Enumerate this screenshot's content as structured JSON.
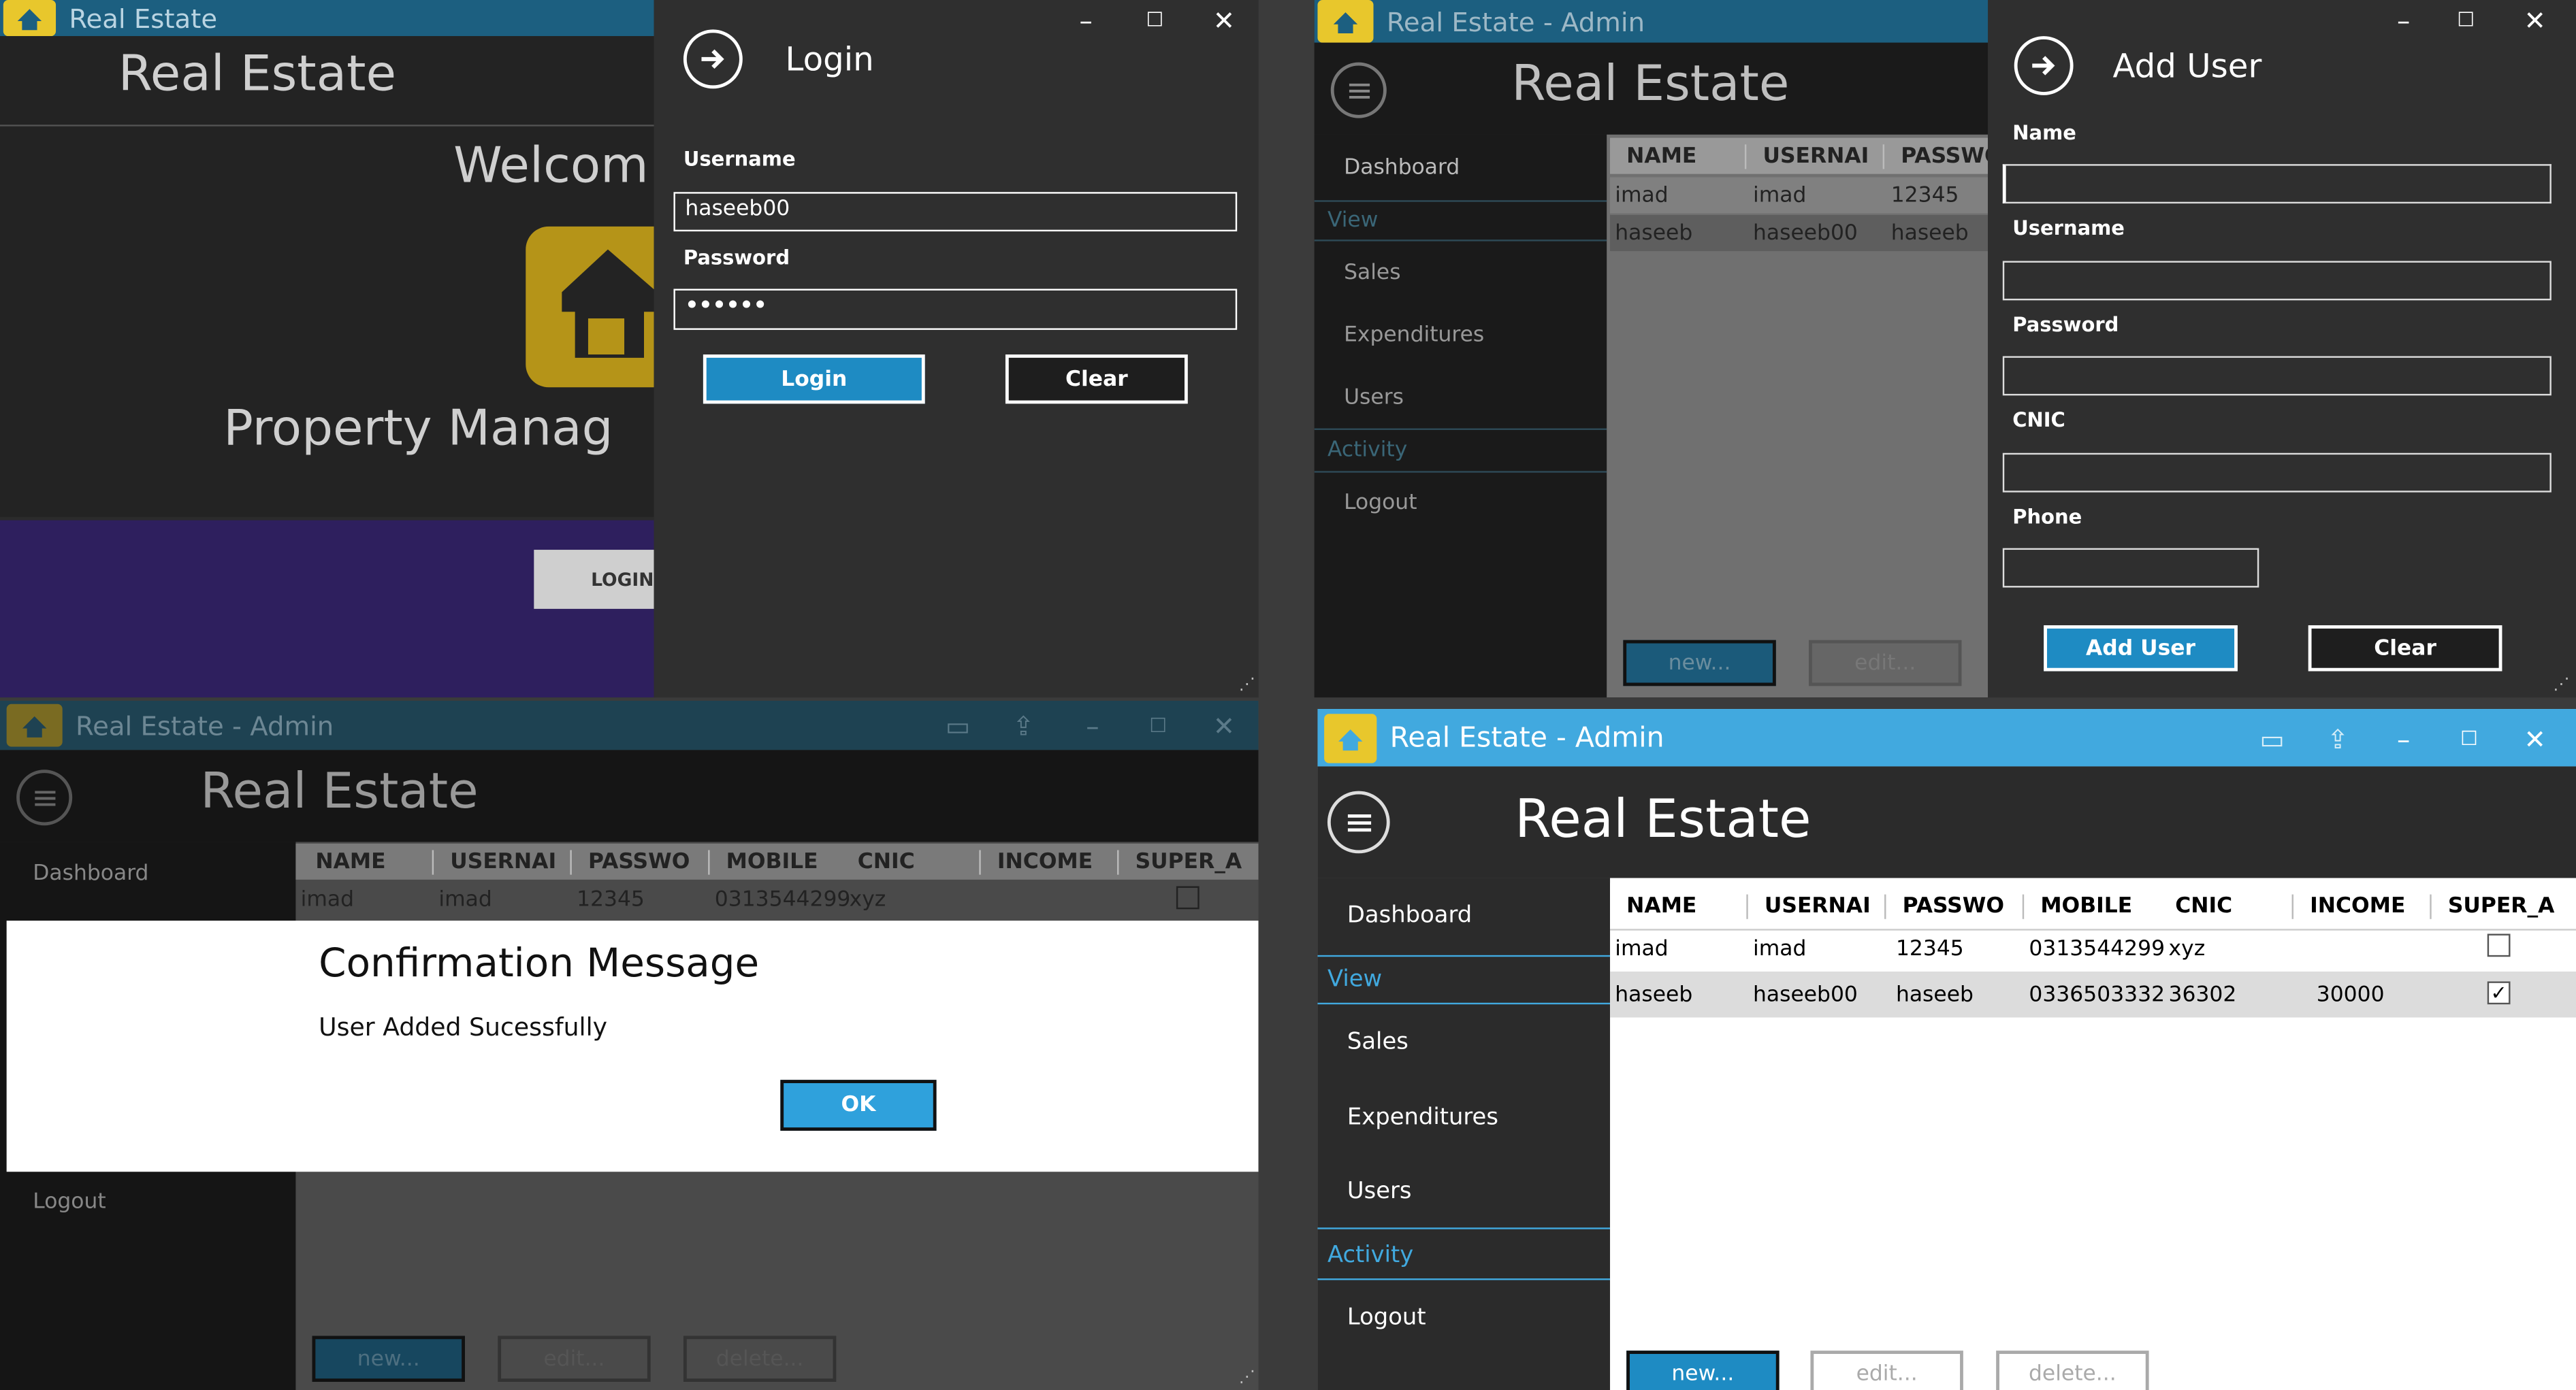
{
  "q1": {
    "window_title": "Real Estate",
    "app_title": "Real Estate",
    "welcome": "Welcom",
    "subtitle": "Property Manag",
    "login_button": "LOGIN",
    "login_flyout": {
      "title": "Login",
      "username_label": "Username",
      "username_value": "haseeb00",
      "password_label": "Password",
      "password_value": "••••••",
      "login_label": "Login",
      "clear_label": "Clear"
    }
  },
  "q2": {
    "window_title": "Real Estate - Admin",
    "app_title": "Real Estate",
    "sidebar": {
      "dashboard": "Dashboard",
      "view_header": "View",
      "sales": "Sales",
      "expenditures": "Expenditures",
      "users": "Users",
      "activity_header": "Activity",
      "logout": "Logout"
    },
    "grid": {
      "headers": [
        "NAME",
        "USERNAI",
        "PASSWO"
      ],
      "rows": [
        [
          "imad",
          "imad",
          "12345"
        ],
        [
          "haseeb",
          "haseeb00",
          "haseeb"
        ]
      ]
    },
    "new_label": "new...",
    "edit_label": "edit...",
    "flyout": {
      "title": "Add User",
      "name_label": "Name",
      "username_label": "Username",
      "password_label": "Password",
      "cnic_label": "CNIC",
      "phone_label": "Phone",
      "add_label": "Add User",
      "clear_label": "Clear"
    }
  },
  "q3": {
    "window_title": "Real Estate - Admin",
    "app_title": "Real Estate",
    "sidebar": {
      "dashboard": "Dashboard",
      "logout": "Logout"
    },
    "grid": {
      "headers": [
        "NAME",
        "USERNAI",
        "PASSWO",
        "MOBILE",
        "CNIC",
        "INCOME",
        "SUPER_A"
      ],
      "rows": [
        [
          "imad",
          "imad",
          "12345",
          "0313544299",
          "xyz",
          "",
          ""
        ]
      ]
    },
    "dialog": {
      "title": "Confirmation Message",
      "message": "User Added Sucessfully",
      "ok_label": "OK"
    },
    "new_label": "new...",
    "edit_label": "edit...",
    "delete_label": "delete..."
  },
  "q4": {
    "window_title": "Real Estate - Admin",
    "app_title": "Real Estate",
    "sidebar": {
      "dashboard": "Dashboard",
      "view_header": "View",
      "sales": "Sales",
      "expenditures": "Expenditures",
      "users": "Users",
      "activity_header": "Activity",
      "logout": "Logout"
    },
    "grid": {
      "headers": [
        "NAME",
        "USERNAI",
        "PASSWO",
        "MOBILE",
        "CNIC",
        "INCOME",
        "SUPER_A"
      ],
      "rows": [
        {
          "cells": [
            "imad",
            "imad",
            "12345",
            "0313544299",
            "xyz",
            ""
          ],
          "super_admin": false
        },
        {
          "cells": [
            "haseeb",
            "haseeb00",
            "haseeb",
            "0336503332",
            "36302",
            "30000"
          ],
          "super_admin": true
        }
      ]
    },
    "new_label": "new...",
    "edit_label": "edit...",
    "delete_label": "delete..."
  },
  "colors": {
    "accent_blue": "#1e8bc3",
    "titlebar_blue": "#41a9df",
    "logo_yellow": "#e8c72c",
    "dark_bg": "#232323",
    "sidebar_bg": "#2b2b2b"
  },
  "icons": [
    "app-logo-icon",
    "hamburger-icon",
    "arrow-right-icon",
    "minimize-icon",
    "maximize-icon",
    "close-icon",
    "book-icon",
    "share-icon",
    "checkbox-icon",
    "resize-grip-icon",
    "house-logo-icon"
  ]
}
